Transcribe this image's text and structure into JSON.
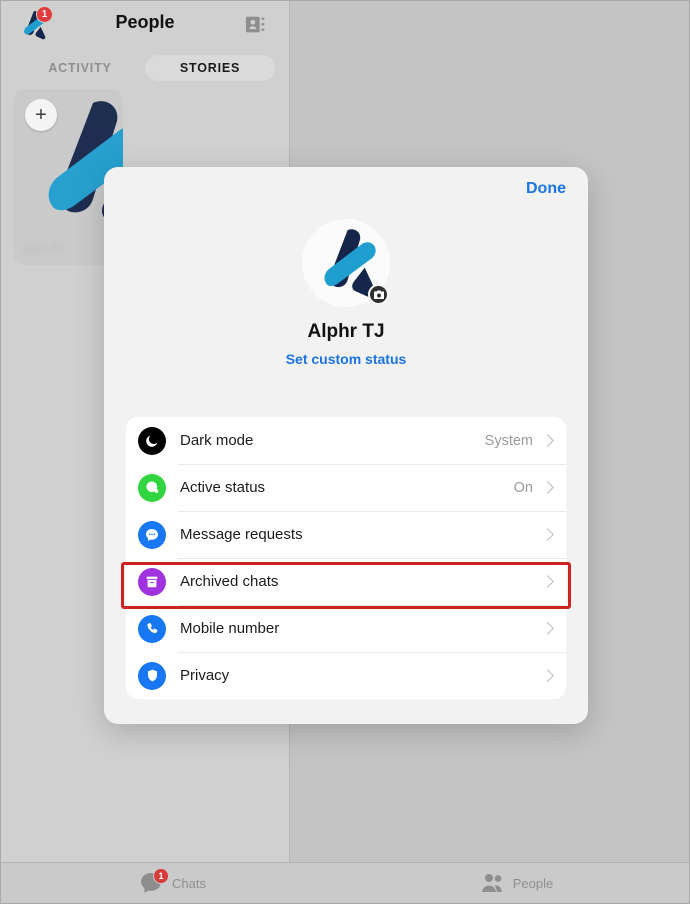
{
  "background": {
    "header": {
      "title": "People",
      "avatar_badge": "1",
      "avatar_icon": "app-logo-avatar",
      "contacts_icon": "contact-card-icon"
    },
    "tabs": [
      {
        "label": "ACTIVITY",
        "active": false
      },
      {
        "label": "STORIES",
        "active": true
      }
    ],
    "story_card": {
      "add_icon": "plus-icon",
      "name": "Alphr TJ"
    },
    "tabbar": [
      {
        "label": "Chats",
        "icon": "chat-bubble-icon",
        "badge": "1"
      },
      {
        "label": "People",
        "icon": "people-icon",
        "badge": ""
      }
    ]
  },
  "modal": {
    "done_label": "Done",
    "avatar_icon": "profile-avatar",
    "camera_icon": "camera-icon",
    "name": "Alphr TJ",
    "status_link": "Set custom status",
    "settings": [
      {
        "label": "Dark mode",
        "value": "System",
        "icon": "moon-icon",
        "icon_color": "#000000",
        "highlighted": false
      },
      {
        "label": "Active status",
        "value": "On",
        "icon": "active-status-icon",
        "icon_color": "#31d53f",
        "highlighted": false
      },
      {
        "label": "Message requests",
        "value": "",
        "icon": "message-requests-icon",
        "icon_color": "#1877f2",
        "highlighted": false
      },
      {
        "label": "Archived chats",
        "value": "",
        "icon": "archive-box-icon",
        "icon_color": "#a033e0",
        "highlighted": true
      },
      {
        "label": "Mobile number",
        "value": "",
        "icon": "phone-icon",
        "icon_color": "#1877f2",
        "highlighted": false
      },
      {
        "label": "Privacy",
        "value": "",
        "icon": "shield-icon",
        "icon_color": "#1877f2",
        "highlighted": false
      }
    ]
  },
  "colors": {
    "accent_blue": "#1b74e4",
    "badge_red": "#e23b3b",
    "highlight_red": "#cc2222"
  }
}
